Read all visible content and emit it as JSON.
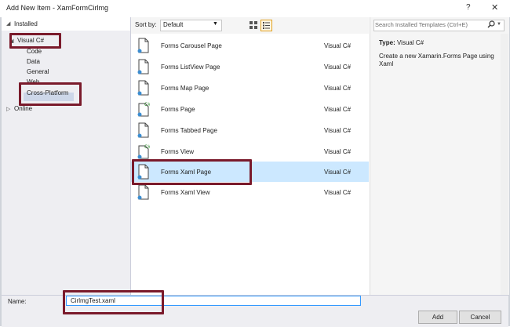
{
  "window": {
    "title": "Add New Item - XamFormCirlmg",
    "help": "?",
    "close": "✕"
  },
  "tree": {
    "installed": "Installed",
    "visual_csharp": "Visual C#",
    "children": [
      "Code",
      "Data",
      "General",
      "Web",
      "Cross-Platform"
    ],
    "online": "Online"
  },
  "sortbar": {
    "label": "Sort by:",
    "selected": "Default"
  },
  "items": [
    {
      "name": "Forms Carousel Page",
      "type": "Visual C#",
      "icon": "forms-page-icon"
    },
    {
      "name": "Forms ListView Page",
      "type": "Visual C#",
      "icon": "forms-page-icon"
    },
    {
      "name": "Forms Map Page",
      "type": "Visual C#",
      "icon": "forms-page-icon"
    },
    {
      "name": "Forms Page",
      "type": "Visual C#",
      "icon": "forms-csharp-icon"
    },
    {
      "name": "Forms Tabbed Page",
      "type": "Visual C#",
      "icon": "forms-page-icon"
    },
    {
      "name": "Forms View",
      "type": "Visual C#",
      "icon": "forms-csharp-icon"
    },
    {
      "name": "Forms Xaml Page",
      "type": "Visual C#",
      "icon": "forms-page-icon",
      "selected": true
    },
    {
      "name": "Forms Xaml View",
      "type": "Visual C#",
      "icon": "forms-page-icon"
    }
  ],
  "details": {
    "search_placeholder": "Search Installed Templates (Ctrl+E)",
    "type_label": "Type:",
    "type_value": "Visual C#",
    "description": "Create a new Xamarin.Forms Page using Xaml"
  },
  "bottom": {
    "name_label": "Name:",
    "name_value": "CirlmgTest.xaml",
    "add": "Add",
    "cancel": "Cancel"
  },
  "colors": {
    "selection": "#cce8ff",
    "annotation": "#7a1a2b",
    "tree_highlight": "#cdd7e9"
  }
}
